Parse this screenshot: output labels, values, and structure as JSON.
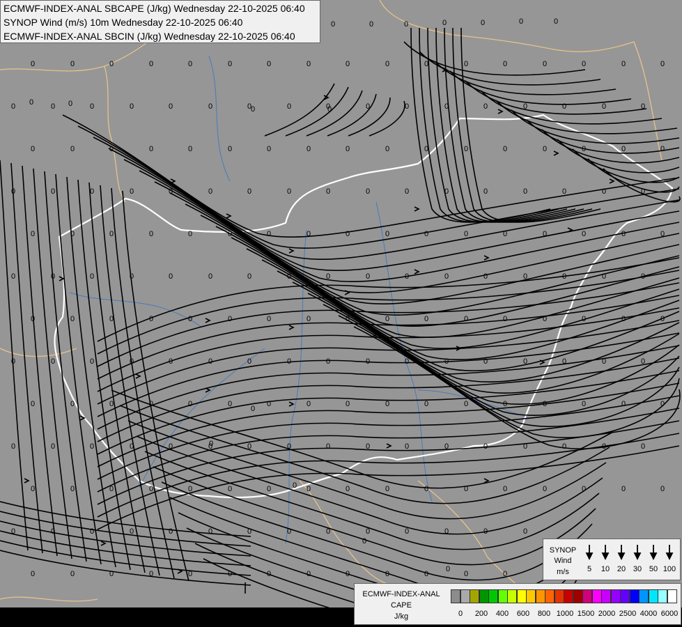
{
  "header": {
    "line1": "ECMWF-INDEX-ANAL SBCAPE (J/kg) Wednesday 22-10-2025 06:40",
    "line2": "SYNOP Wind (m/s) 10m Wednesday 22-10-2025 06:40",
    "line3": "ECMWF-INDEX-ANAL SBCIN (J/kg) Wednesday 22-10-2025 06:40"
  },
  "map": {
    "background_color": "#969696",
    "streamline_color": "#000000",
    "country_border_color": "#e6c38c",
    "focus_border_color": "#ffffff",
    "river_color": "#4a7ab8",
    "value_label": "0",
    "value_label_color": "#000000"
  },
  "wind_legend": {
    "title_line1": "SYNOP",
    "title_line2": "Wind",
    "unit": "m/s",
    "speeds": [
      "5",
      "10",
      "20",
      "30",
      "50",
      "100"
    ]
  },
  "cape_legend": {
    "title": "ECMWF-INDEX-ANAL",
    "subtitle": "CAPE",
    "unit": "J/kg",
    "colors": [
      "#8c8c8c",
      "#aaaaaa",
      "#a5a500",
      "#009600",
      "#00c800",
      "#64ff00",
      "#c8ff00",
      "#ffff00",
      "#ffc800",
      "#ff9600",
      "#ff6400",
      "#e63200",
      "#c80000",
      "#a00000",
      "#d2007d",
      "#ff00ff",
      "#c800ff",
      "#9600ff",
      "#6400ff",
      "#0000ff",
      "#0096ff",
      "#00e6ff",
      "#96ffff",
      "#ffffff"
    ],
    "ticks": [
      "0",
      "200",
      "400",
      "600",
      "800",
      "1000",
      "1500",
      "2000",
      "2500",
      "4000",
      "6000"
    ]
  }
}
